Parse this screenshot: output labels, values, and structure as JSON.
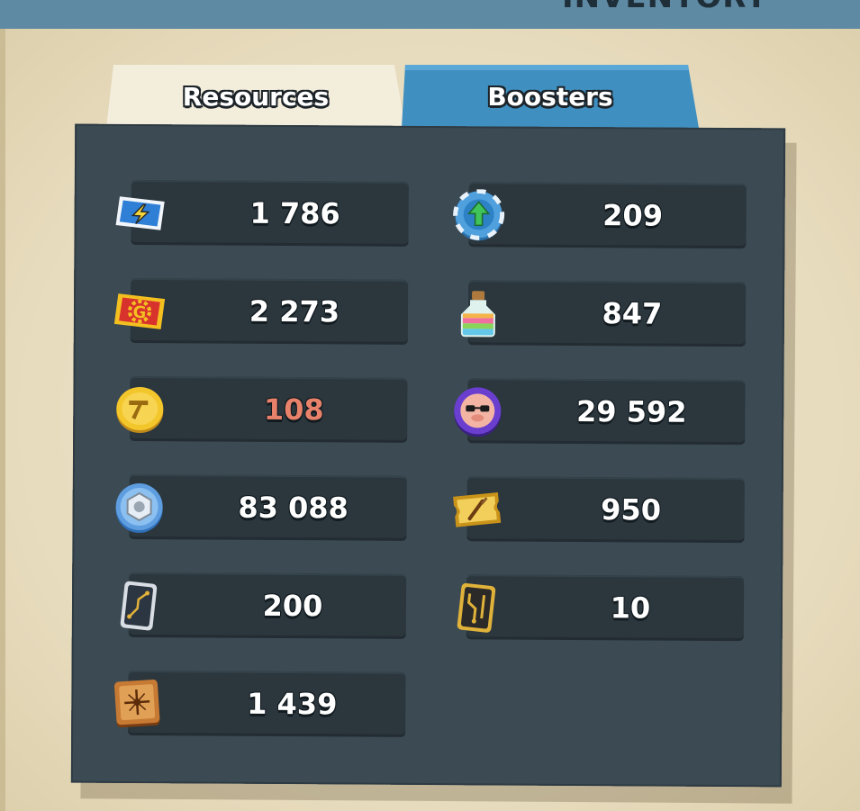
{
  "header": {
    "title": "INVENTORY"
  },
  "tabs": [
    {
      "label": "Resources",
      "active": true
    },
    {
      "label": "Boosters",
      "active": false
    }
  ],
  "resources_left": [
    {
      "icon": "energy-ticket-icon",
      "value": "1 786"
    },
    {
      "icon": "gear-ticket-icon",
      "value": "2 273"
    },
    {
      "icon": "hammer-coin-icon",
      "value": "108",
      "color": "#e8826a"
    },
    {
      "icon": "hex-nut-icon",
      "value": "83 088"
    },
    {
      "icon": "circuit-card-icon",
      "value": "200"
    },
    {
      "icon": "bronze-tile-icon",
      "value": "1 439"
    }
  ],
  "resources_right": [
    {
      "icon": "upgrade-arrow-token-icon",
      "value": "209"
    },
    {
      "icon": "potion-bottle-icon",
      "value": "847"
    },
    {
      "icon": "pig-sunglasses-coin-icon",
      "value": "29 592"
    },
    {
      "icon": "paintbrush-ticket-icon",
      "value": "950"
    },
    {
      "icon": "gold-circuit-card-icon",
      "value": "10"
    }
  ]
}
